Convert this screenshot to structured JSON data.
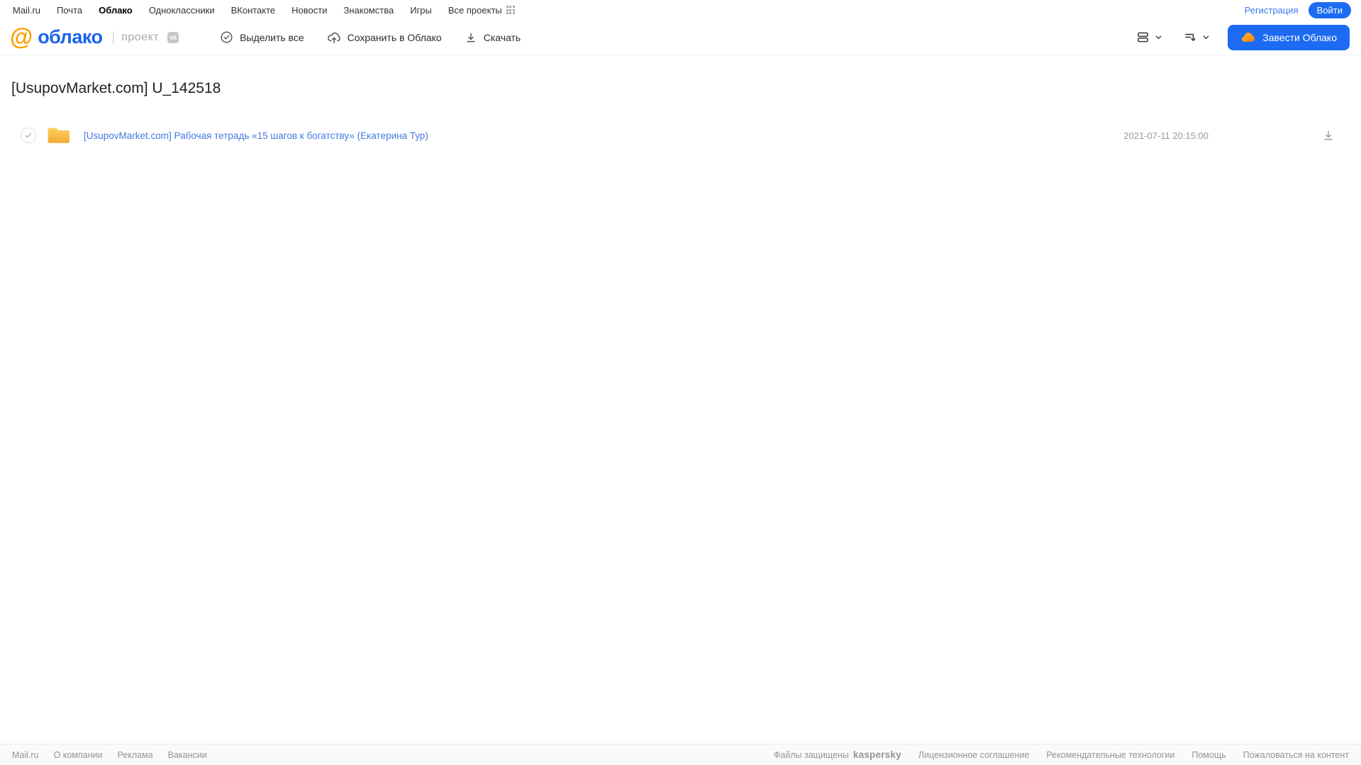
{
  "topnav": {
    "items": [
      {
        "label": "Mail.ru"
      },
      {
        "label": "Почта"
      },
      {
        "label": "Облако",
        "active": true
      },
      {
        "label": "Одноклассники"
      },
      {
        "label": "ВКонтакте"
      },
      {
        "label": "Новости"
      },
      {
        "label": "Знакомства"
      },
      {
        "label": "Игры"
      },
      {
        "label": "Все проекты"
      }
    ],
    "register_label": "Регистрация",
    "login_label": "Войти"
  },
  "header": {
    "logo_at": "@",
    "logo_text": "облако",
    "separator": "|",
    "project_label": "проект",
    "project_badge": "vk",
    "actions": {
      "select_all": "Выделить все",
      "save_to_cloud": "Сохранить в Облако",
      "download": "Скачать"
    },
    "get_cloud_label": "Завести Облако"
  },
  "main": {
    "title": "[UsupovMarket.com] U_142518",
    "files": [
      {
        "type": "folder",
        "name": "[UsupovMarket.com] Рабочая тетрадь «15 шагов к богатству» (Екатерина Тур)",
        "date": "2021-07-11 20:15:00"
      }
    ]
  },
  "footer": {
    "left_links": [
      "Mail.ru",
      "О компании",
      "Реклама",
      "Вакансии"
    ],
    "protected_label": "Файлы защищены",
    "kaspersky_label": "kaspersky",
    "right_links": [
      "Лицензионное соглашение",
      "Рекомендательные технологии",
      "Помощь",
      "Пожаловаться на контент"
    ]
  },
  "colors": {
    "primary_blue": "#1d6bf3",
    "logo_orange": "#ff9e00",
    "logo_blue": "#1b63ec",
    "link_blue": "#4579e0",
    "folder_yellow": "#f7b733",
    "kaspersky_teal": "#00a88e"
  }
}
